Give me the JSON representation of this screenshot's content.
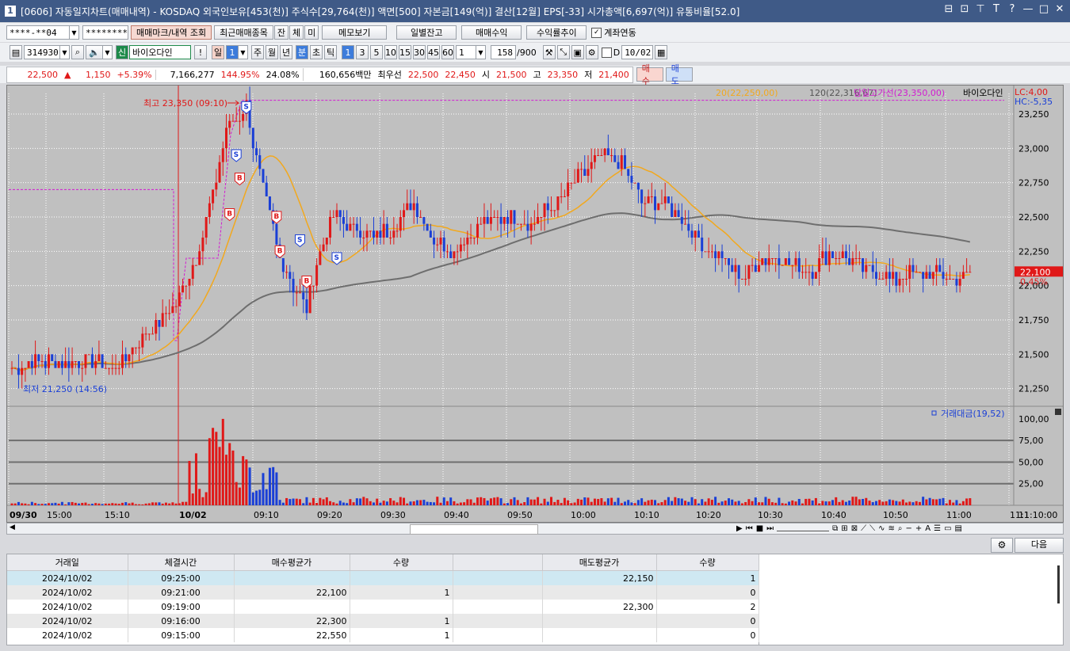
{
  "window": {
    "icon_label": "1",
    "title": "[0606] 자동일지차트(매매내역) - KOSDAQ 외국인보유[453(천)] 주식수[29,764(천)] 액면[500] 자본금[149(억)] 결산[12월] EPS[-33] 시가총액[6,697(억)] 유통비율[52.0]",
    "controls": [
      "⊟",
      "⊡",
      "⊤",
      "T",
      "?",
      "—",
      "□",
      "✕"
    ]
  },
  "toolbar1": {
    "account": "****-**04",
    "password": "********",
    "btn_trade_marks": "매매마크/내역 조회",
    "btn_recent": "최근매매종목",
    "btn_jan": "잔",
    "btn_che": "체",
    "btn_mi": "미",
    "btn_memo": "메모보기",
    "btn_daily_balance": "일별잔고",
    "btn_trade_profit": "매매수익",
    "btn_profit_trend": "수익률추이",
    "account_link_label": "계좌연동",
    "account_link_checked": true
  },
  "toolbar2": {
    "code": "314930",
    "shin_label": "신",
    "stock_name": "바이오다인",
    "exclaim": "!",
    "period_day": "일",
    "period_num": "1",
    "period_week": "주",
    "period_month": "월",
    "period_year": "년",
    "period_minute": "분",
    "period_second": "초",
    "period_tick": "틱",
    "minute_options": [
      "1",
      "3",
      "5",
      "10",
      "15",
      "30",
      "45",
      "60"
    ],
    "active_minute": "1",
    "multiplier": "1",
    "count": "158",
    "count_max": "/900",
    "date_checkbox_label": "D",
    "date": "10/02"
  },
  "quote": {
    "price": "22,500",
    "arrow": "▲",
    "change": "1,150",
    "change_pct": "+5.39%",
    "volume": "7,166,277",
    "vol_ratio": "144.95%",
    "turnover": "24.08%",
    "amount": "160,656백만",
    "best_sell_label": "최우선",
    "best_sell": "22,500",
    "best_buy": "22,450",
    "open_label": "시",
    "open": "21,500",
    "high_label": "고",
    "high": "23,350",
    "low_label": "저",
    "low": "21,400",
    "buy_btn": "매수",
    "sell_btn": "매도"
  },
  "chart": {
    "legend_ma20": "20(22,250,00)",
    "legend_ma120": "120(22,316,67)",
    "legend_high_line": "당일고가선(23,350,00)",
    "legend_name": "바이오다인",
    "lc": "LC:4,00",
    "hc": "HC:-5,35",
    "max_label": "최고 23,350 (09:10)",
    "min_label": "최저 21,250 (14:56)",
    "current_price_tag": "22,100",
    "current_pct_tag": "0,45%",
    "price_ticks": [
      "23,250",
      "23,000",
      "22,750",
      "22,500",
      "22,250",
      "22,000",
      "21,750",
      "21,500",
      "21,250"
    ],
    "volume_legend": "거래대금(19,52)",
    "volume_ticks": [
      "100,00",
      "75,00",
      "50,00",
      "25,00"
    ],
    "time_labels": [
      "09/30",
      "15:00",
      "15:10",
      "10/02",
      "09:10",
      "09:20",
      "09:30",
      "09:40",
      "09:50",
      "10:00",
      "10:10",
      "10:20",
      "10:30",
      "10:40",
      "10:50",
      "11:00",
      "11:1"
    ],
    "time_corner": "11:10:00"
  },
  "chart_data": {
    "type": "candlestick",
    "ylim": [
      21150,
      23400
    ],
    "volume_ylim": [
      0,
      110
    ],
    "high_line": 23350,
    "prev_high_line": 22700,
    "markers": [
      {
        "label": "S",
        "kind": "sell",
        "bar": 70,
        "price": 23300
      },
      {
        "label": "S",
        "kind": "sell",
        "bar": 67,
        "price": 22950
      },
      {
        "label": "B",
        "kind": "buy",
        "bar": 68,
        "price": 22780
      },
      {
        "label": "B",
        "kind": "buy",
        "bar": 65,
        "price": 22520
      },
      {
        "label": "B",
        "kind": "buy",
        "bar": 79,
        "price": 22500
      },
      {
        "label": "B",
        "kind": "buy",
        "bar": 80,
        "price": 22250
      },
      {
        "label": "S",
        "kind": "sell",
        "bar": 86,
        "price": 22330
      },
      {
        "label": "B",
        "kind": "buy",
        "bar": 88,
        "price": 22030
      },
      {
        "label": "S",
        "kind": "sell",
        "bar": 97,
        "price": 22200
      }
    ]
  },
  "grid": {
    "more_button": "다음",
    "headers": [
      "거래일",
      "체결시간",
      "매수평균가",
      "수량",
      "",
      "매도평균가",
      "수량"
    ],
    "rows": [
      [
        "2024/10/02",
        "09:25:00",
        "",
        "",
        "",
        "22,150",
        "1"
      ],
      [
        "2024/10/02",
        "09:21:00",
        "22,100",
        "1",
        "",
        "",
        "0"
      ],
      [
        "2024/10/02",
        "09:19:00",
        "",
        "",
        "",
        "22,300",
        "2"
      ],
      [
        "2024/10/02",
        "09:16:00",
        "22,300",
        "1",
        "",
        "",
        "0"
      ],
      [
        "2024/10/02",
        "09:15:00",
        "22,550",
        "1",
        "",
        "",
        "0"
      ]
    ]
  }
}
